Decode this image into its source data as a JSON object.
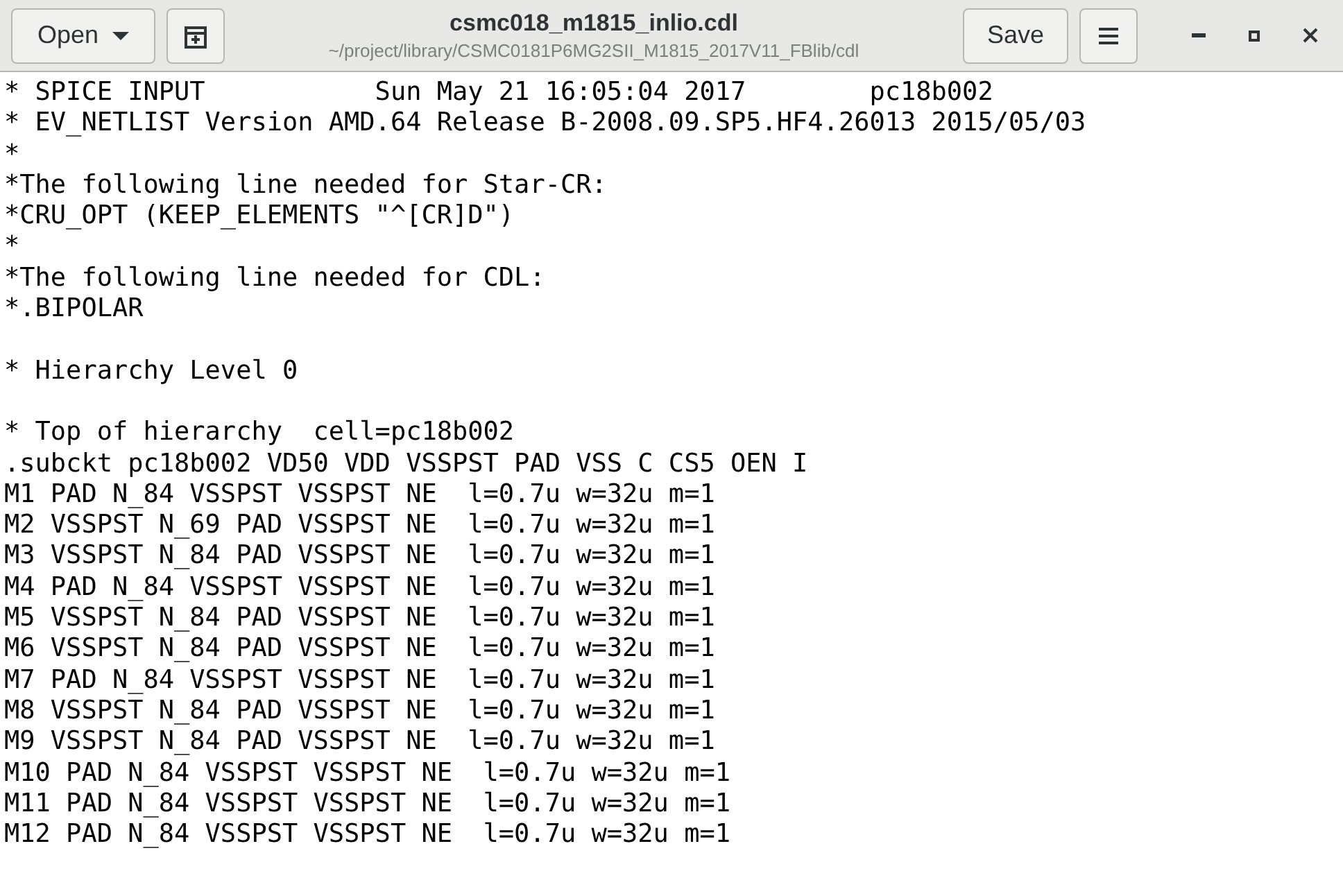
{
  "header": {
    "open_button": "Open",
    "title": "csmc018_m1815_inlio.cdl",
    "subtitle": "~/project/library/CSMC0181P6MG2SII_M1815_2017V11_FBlib/cdl",
    "save_button": "Save"
  },
  "editor": {
    "lines": [
      {
        "kind": "text",
        "text": "* SPICE INPUT           Sun May 21 16:05:04 2017        pc18b002"
      },
      {
        "kind": "text",
        "text": "* EV_NETLIST Version AMD.64 Release B-2008.09.SP5.HF4.26013 2015/05/03"
      },
      {
        "kind": "text",
        "text": "*"
      },
      {
        "kind": "text",
        "text": "*The following line needed for Star-CR:"
      },
      {
        "kind": "text",
        "text": "*CRU_OPT (KEEP_ELEMENTS \"^[CR]D\")"
      },
      {
        "kind": "text",
        "text": "*"
      },
      {
        "kind": "text",
        "text": "*The following line needed for CDL:"
      },
      {
        "kind": "text",
        "text": "*.BIPOLAR"
      },
      {
        "kind": "blank"
      },
      {
        "kind": "text",
        "text": "* Hierarchy Level 0"
      },
      {
        "kind": "blank"
      },
      {
        "kind": "text",
        "text": "* Top of hierarchy  cell=pc18b002"
      },
      {
        "kind": "text",
        "text": ".subckt pc18b002 VD50 VDD VSSPST PAD VSS C CS5 OEN I"
      },
      {
        "kind": "text",
        "text": "M1 PAD N_84 VSSPST VSSPST NE  l=0.7u w=32u m=1"
      },
      {
        "kind": "text",
        "text": "M2 VSSPST N_69 PAD VSSPST NE  l=0.7u w=32u m=1"
      },
      {
        "kind": "text",
        "text": "M3 VSSPST N_84 PAD VSSPST NE  l=0.7u w=32u m=1"
      },
      {
        "kind": "text",
        "text": "M4 PAD N_84 VSSPST VSSPST NE  l=0.7u w=32u m=1"
      },
      {
        "kind": "text",
        "text": "M5 VSSPST N_84 PAD VSSPST NE  l=0.7u w=32u m=1"
      },
      {
        "kind": "text",
        "text": "M6 VSSPST N_84 PAD VSSPST NE  l=0.7u w=32u m=1"
      },
      {
        "kind": "text",
        "text": "M7 PAD N_84 VSSPST VSSPST NE  l=0.7u w=32u m=1"
      },
      {
        "kind": "text",
        "text": "M8 VSSPST N_84 PAD VSSPST NE  l=0.7u w=32u m=1"
      },
      {
        "kind": "text",
        "text": "M9 VSSPST N_84 PAD VSSPST NE  l=0.7u w=32u m=1"
      },
      {
        "kind": "text",
        "text": "M10 PAD N_84 VSSPST VSSPST NE  l=0.7u w=32u m=1"
      },
      {
        "kind": "text",
        "text": "M11 PAD N_84 VSSPST VSSPST NE  l=0.7u w=32u m=1"
      },
      {
        "kind": "text",
        "text": "M12 PAD N_84 VSSPST VSSPST NE  l=0.7u w=32u m=1"
      }
    ]
  }
}
